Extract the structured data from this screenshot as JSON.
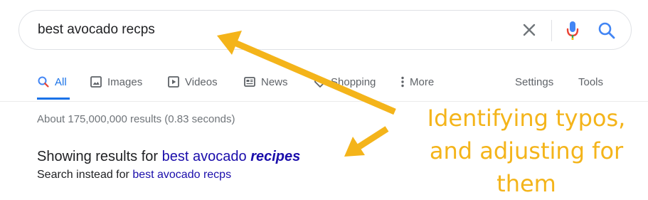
{
  "search": {
    "query": "best avocado recps"
  },
  "tabs": [
    {
      "label": "All",
      "icon": "search-icon",
      "active": true
    },
    {
      "label": "Images",
      "icon": "image-icon"
    },
    {
      "label": "Videos",
      "icon": "play-icon"
    },
    {
      "label": "News",
      "icon": "news-icon"
    },
    {
      "label": "Shopping",
      "icon": "tag-icon"
    },
    {
      "label": "More",
      "icon": "more-vert-icon"
    }
  ],
  "tools": {
    "settings_label": "Settings",
    "tools_label": "Tools"
  },
  "results": {
    "stats": "About 175,000,000 results (0.83 seconds)",
    "showing_prefix": "Showing results for",
    "corrected_plain": "best avocado",
    "corrected_bold": "recipes",
    "instead_prefix": "Search instead for",
    "original_query": "best avocado recps"
  },
  "annotation": {
    "lines": [
      "Identifying typos,",
      "and adjusting for",
      "them"
    ],
    "color": "#f4b41a"
  },
  "colors": {
    "accent": "#1a73e8",
    "link": "#1a0dab",
    "muted": "#70757a"
  }
}
